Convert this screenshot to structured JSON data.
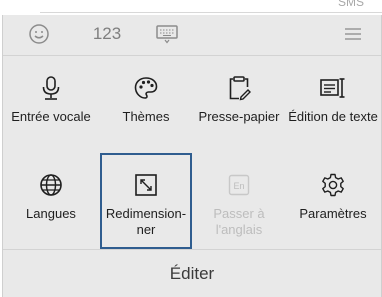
{
  "app_top": {
    "sms_label": "SMS"
  },
  "toolbar": {
    "emoji_icon": "smiley-icon",
    "numbers_label": "123",
    "keyboard_icon": "keyboard-icon",
    "menu_icon": "hamburger-icon"
  },
  "tiles": [
    {
      "label": "Entrée vocale",
      "icon": "microphone-icon",
      "enabled": true,
      "selected": false
    },
    {
      "label": "Thèmes",
      "icon": "palette-icon",
      "enabled": true,
      "selected": false
    },
    {
      "label": "Presse-papier",
      "icon": "clipboard-icon",
      "enabled": true,
      "selected": false
    },
    {
      "label": "Édition de texte",
      "icon": "text-edit-icon",
      "enabled": true,
      "selected": false
    },
    {
      "label": "Langues",
      "icon": "globe-icon",
      "enabled": true,
      "selected": false
    },
    {
      "label": "Redimension-\nner",
      "icon": "resize-icon",
      "enabled": true,
      "selected": true
    },
    {
      "label": "Passer à\nl'anglais",
      "icon": "en-icon",
      "enabled": false,
      "selected": false
    },
    {
      "label": "Paramètres",
      "icon": "settings-gear-icon",
      "enabled": true,
      "selected": false
    }
  ],
  "en_badge": "En",
  "footer": {
    "label": "Éditer"
  },
  "colors": {
    "panel_bg": "#e9e9e9",
    "selected_border": "#2f5d8f",
    "disabled_text": "#bdbdbd",
    "icon_gray": "#8c8c8c"
  }
}
